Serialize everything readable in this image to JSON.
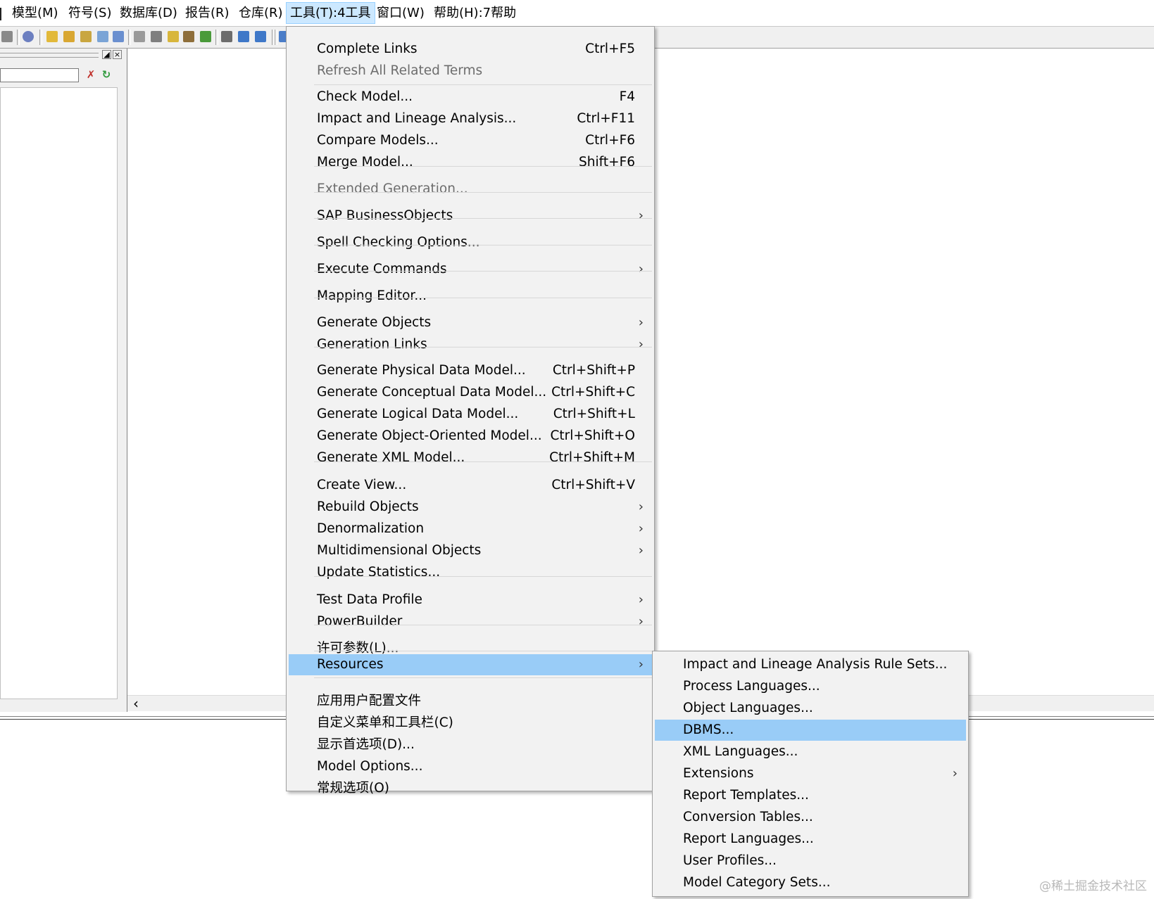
{
  "menubar": {
    "items": [
      {
        "label": "模型(M)"
      },
      {
        "label": "符号(S)"
      },
      {
        "label": "数据库(D)"
      },
      {
        "label": "报告(R)"
      },
      {
        "label": "仓库(R)"
      },
      {
        "label": "工具(T):4工具"
      },
      {
        "label": "窗口(W)"
      },
      {
        "label": "帮助(H):7帮助"
      }
    ]
  },
  "tools_menu": {
    "items": [
      {
        "label": "Complete Links",
        "shortcut": "Ctrl+F5"
      },
      {
        "label": "Refresh All Related Terms"
      },
      {
        "label": "Check Model...",
        "shortcut": "F4"
      },
      {
        "label": "Impact and Lineage Analysis...",
        "shortcut": "Ctrl+F11"
      },
      {
        "label": "Compare Models...",
        "shortcut": "Ctrl+F6"
      },
      {
        "label": "Merge Model...",
        "shortcut": "Shift+F6"
      },
      {
        "label": "Extended Generation..."
      },
      {
        "label": "SAP BusinessObjects"
      },
      {
        "label": "Spell Checking Options..."
      },
      {
        "label": "Execute Commands"
      },
      {
        "label": "Mapping Editor..."
      },
      {
        "label": "Generate Objects"
      },
      {
        "label": "Generation Links"
      },
      {
        "label": "Generate Physical Data Model...",
        "shortcut": "Ctrl+Shift+P"
      },
      {
        "label": "Generate Conceptual Data Model...",
        "shortcut": "Ctrl+Shift+C"
      },
      {
        "label": "Generate Logical Data Model...",
        "shortcut": "Ctrl+Shift+L"
      },
      {
        "label": "Generate Object-Oriented Model...",
        "shortcut": "Ctrl+Shift+O"
      },
      {
        "label": "Generate XML Model...",
        "shortcut": "Ctrl+Shift+M"
      },
      {
        "label": "Create View...",
        "shortcut": "Ctrl+Shift+V"
      },
      {
        "label": "Rebuild Objects"
      },
      {
        "label": "Denormalization"
      },
      {
        "label": "Multidimensional Objects"
      },
      {
        "label": "Update Statistics..."
      },
      {
        "label": "Test Data Profile"
      },
      {
        "label": "PowerBuilder"
      },
      {
        "label": "许可参数(L)..."
      },
      {
        "label": "Resources"
      },
      {
        "label": "应用用户配置文件"
      },
      {
        "label": "自定义菜单和工具栏(C)"
      },
      {
        "label": "显示首选项(D)..."
      },
      {
        "label": "Model Options..."
      },
      {
        "label": "常规选项(O)"
      }
    ]
  },
  "resources_menu": {
    "items": [
      {
        "label": "Impact and Lineage Analysis Rule Sets..."
      },
      {
        "label": "Process Languages..."
      },
      {
        "label": "Object Languages..."
      },
      {
        "label": "DBMS..."
      },
      {
        "label": "XML Languages..."
      },
      {
        "label": "Extensions"
      },
      {
        "label": "Report Templates..."
      },
      {
        "label": "Conversion Tables..."
      },
      {
        "label": "Report Languages..."
      },
      {
        "label": "User Profiles..."
      },
      {
        "label": "Model Category Sets..."
      }
    ]
  },
  "watermark": {
    "text": "@稀土掘金技术社区"
  },
  "colors": {
    "menu_bg": "#f2f2f2",
    "highlight": "#99ccf7",
    "menubar_active": "#cce8ff",
    "disabled_text": "#6d6d6d"
  },
  "icons": {
    "submenu_arrow": "chevron-right-icon",
    "scroll_left": "chevron-left-icon"
  }
}
